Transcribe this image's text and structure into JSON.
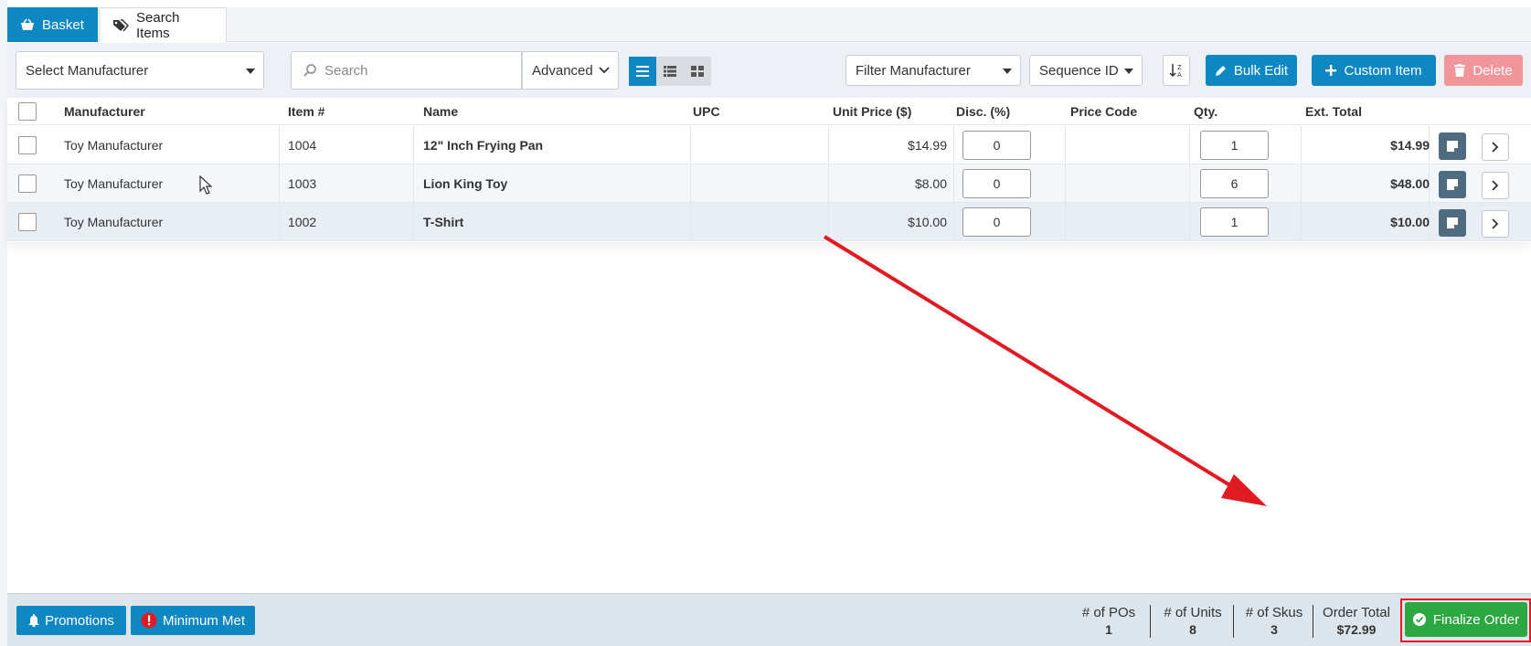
{
  "tabs": [
    {
      "label": "Basket",
      "icon": "basket-icon",
      "active": true
    },
    {
      "label": "Search Items",
      "icon": "tags-icon",
      "active": false
    }
  ],
  "toolbar": {
    "manufacturer_select": "Select Manufacturer",
    "search_placeholder": "Search",
    "advanced_label": "Advanced",
    "filter_manufacturer": "Filter Manufacturer",
    "sort_select": "Sequence ID",
    "bulk_edit": "Bulk Edit",
    "custom_item": "Custom Item",
    "delete": "Delete"
  },
  "table": {
    "headers": {
      "manufacturer": "Manufacturer",
      "item": "Item #",
      "name": "Name",
      "upc": "UPC",
      "unit_price": "Unit Price ($)",
      "disc": "Disc. (%)",
      "price_code": "Price Code",
      "qty": "Qty.",
      "ext_total": "Ext. Total"
    },
    "rows": [
      {
        "manufacturer": "Toy Manufacturer",
        "item": "1004",
        "name": "12\" Inch Frying Pan",
        "upc": "",
        "unit_price": "$14.99",
        "disc": "0",
        "price_code": "",
        "qty": "1",
        "ext_total": "$14.99"
      },
      {
        "manufacturer": "Toy Manufacturer",
        "item": "1003",
        "name": "Lion King Toy",
        "upc": "",
        "unit_price": "$8.00",
        "disc": "0",
        "price_code": "",
        "qty": "6",
        "ext_total": "$48.00"
      },
      {
        "manufacturer": "Toy Manufacturer",
        "item": "1002",
        "name": "T-Shirt",
        "upc": "",
        "unit_price": "$10.00",
        "disc": "0",
        "price_code": "",
        "qty": "1",
        "ext_total": "$10.00"
      }
    ]
  },
  "footer": {
    "promotions": "Promotions",
    "minimum_met": "Minimum Met",
    "stats": [
      {
        "label": "# of POs",
        "value": "1"
      },
      {
        "label": "# of Units",
        "value": "8"
      },
      {
        "label": "# of Skus",
        "value": "3"
      },
      {
        "label": "Order Total",
        "value": "$72.99"
      }
    ],
    "finalize": "Finalize Order"
  },
  "colors": {
    "primary": "#0f87c2",
    "danger_disabled": "#f0969a",
    "success": "#2da742",
    "annotation_red": "#e21a22"
  }
}
